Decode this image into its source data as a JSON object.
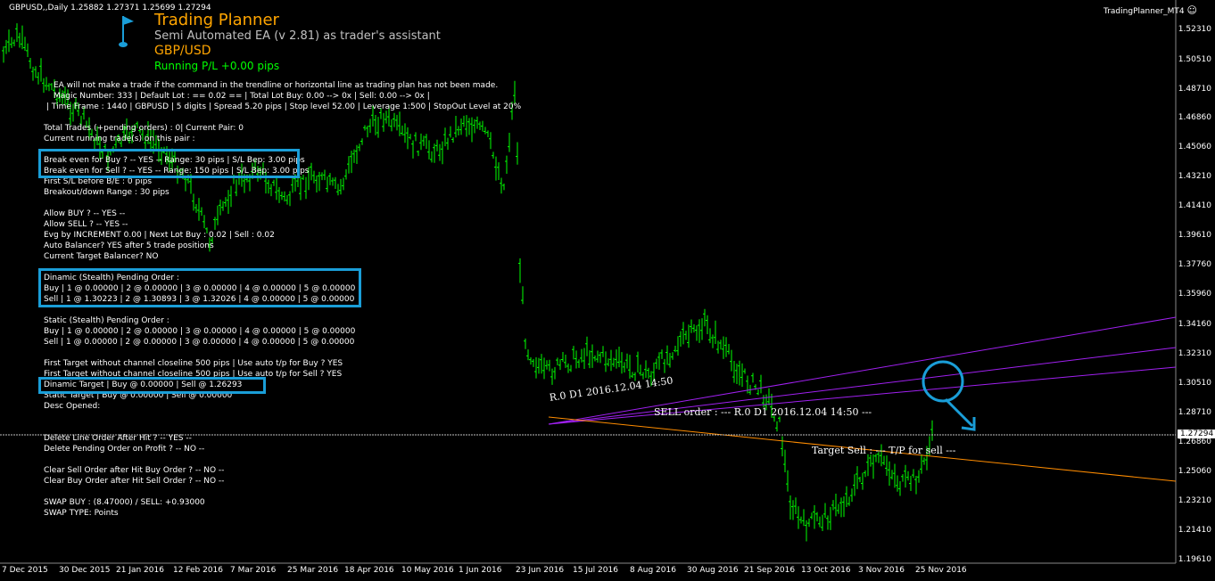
{
  "header": {
    "symbol_line": "GBPUSD,,Daily  1.25882 1.27371 1.25699 1.27294",
    "indicator_name": "TradingPlanner_MT4",
    "smiley": "☺"
  },
  "ea": {
    "title": "Trading Planner",
    "subtitle": "Semi Automated EA (v 2.81) as trader's assistant",
    "pair": "GBP/USD",
    "running_pl": "Running P/L +0.00 pips"
  },
  "info_lines": [
    "EA will not make a trade if the command in the trendline or horizontal line as trading plan has not been made.",
    "Magic Number: 333 | Default Lot : == 0.02 == | Total Lot Buy: 0.00 --> 0x | Sell: 0.00 --> 0x |",
    "| Time Frame : 1440 | GBPUSD | 5 digits | Spread 5.20 pips | Stop level 52.00 | Leverage  1:500 | StopOut Level at 20%"
  ],
  "status_lines": [
    "Total Trades (+pending orders) : 0| Current Pair: 0",
    "Current running trade(s) on this pair :",
    "",
    "Break even for Buy ? -- YES -- Range: 30 pips | S/L Bep: 3.00 pips",
    "Break even for Sell ? -- YES -- Range: 150 pips | S/L Bep: 3.00 pips",
    "First S/L before B/E : 0 pips",
    "Breakout/down Range : 30 pips",
    "",
    "Allow BUY ? -- YES --",
    "Allow SELL ? -- YES --",
    "Evg by INCREMENT 0.00 | Next Lot Buy : 0.02 | Sell : 0.02",
    "Auto Balancer? YES after 5 trade positions",
    "Current Target Balancer? NO",
    "",
    "Dinamic (Stealth) Pending Order :",
    "     Buy    | 1 @ 0.00000 | 2 @ 0.00000 | 3 @ 0.00000 | 4 @ 0.00000 | 5 @ 0.00000",
    "     Sell    | 1 @ 1.30223 | 2 @ 1.30893 | 3 @ 1.32026 | 4 @ 0.00000 | 5 @ 0.00000",
    "",
    "Static (Stealth) Pending Order :",
    "     Buy    | 1 @ 0.00000 | 2 @ 0.00000 | 3 @ 0.00000 | 4 @ 0.00000 | 5 @ 0.00000",
    "     Sell    | 1 @ 0.00000 | 2 @ 0.00000 | 3 @ 0.00000 | 4 @ 0.00000 | 5 @ 0.00000",
    "",
    "First Target without channel closeline 500 pips | Use auto t/p for Buy ? YES",
    "First Target without channel closeline 500 pips | Use auto t/p for Sell ? YES",
    "Dinamic Target  | Buy @ 0.00000 | Sell @ 1.26293",
    "Static Target     | Buy @ 0.00000 | Sell @ 0.00000",
    "Desc Opened:",
    "",
    "",
    "Delete Line Order After Hit ? -- YES --",
    "Delete Pending Order on Profit ? -- NO --",
    "",
    "Clear Sell Order after Hit Buy Order ? -- NO --",
    "Clear Buy Order after Hit Sell Order ? -- NO --",
    "",
    "SWAP BUY : (8.47000) / SELL: +0.93000",
    "SWAP TYPE: Points"
  ],
  "chart_labels": {
    "sell_order": "SELL order : --- R.0 D1 2016.12.04 14:50 ---",
    "trend_label": "R.0 D1 2016.12.04 14:50",
    "target_sell": "Target Sell : --- T/P for sell ---",
    "current_price": "1.27294"
  },
  "price_axis": [
    "1.52310",
    "1.50510",
    "1.48710",
    "1.46860",
    "1.45060",
    "1.43210",
    "1.41410",
    "1.39610",
    "1.37760",
    "1.35960",
    "1.34160",
    "1.32310",
    "1.30510",
    "1.28710",
    "1.26860",
    "1.25060",
    "1.23210",
    "1.21410",
    "1.19610"
  ],
  "time_axis": [
    "7 Dec 2015",
    "30 Dec 2015",
    "21 Jan 2016",
    "12 Feb 2016",
    "7 Mar 2016",
    "25 Mar 2016",
    "18 Apr 2016",
    "10 May 2016",
    "1 Jun 2016",
    "23 Jun 2016",
    "15 Jul 2016",
    "8 Aug 2016",
    "30 Aug 2016",
    "21 Sep 2016",
    "13 Oct 2016",
    "3 Nov 2016",
    "25 Nov 2016"
  ],
  "colors": {
    "candle": "#00ff00",
    "trend": "#a020f0",
    "target": "#ff8c00",
    "highlight": "#1a9ed8",
    "title": "#ffa500",
    "pl": "#00ff00"
  },
  "chart_data": {
    "type": "line",
    "title": "GBPUSD,,Daily",
    "x": [
      "7 Dec 2015",
      "30 Dec 2015",
      "21 Jan 2016",
      "12 Feb 2016",
      "7 Mar 2016",
      "25 Mar 2016",
      "18 Apr 2016",
      "10 May 2016",
      "1 Jun 2016",
      "23 Jun 2016",
      "15 Jul 2016",
      "8 Aug 2016",
      "30 Aug 2016",
      "21 Sep 2016",
      "13 Oct 2016",
      "3 Nov 2016",
      "25 Nov 2016"
    ],
    "series": [
      {
        "name": "GBPUSD",
        "values": [
          1.51,
          1.48,
          1.44,
          1.435,
          1.415,
          1.43,
          1.455,
          1.45,
          1.46,
          1.35,
          1.32,
          1.31,
          1.32,
          1.3,
          1.22,
          1.24,
          1.25
        ]
      }
    ],
    "ylim": [
      1.1961,
      1.5231
    ]
  }
}
